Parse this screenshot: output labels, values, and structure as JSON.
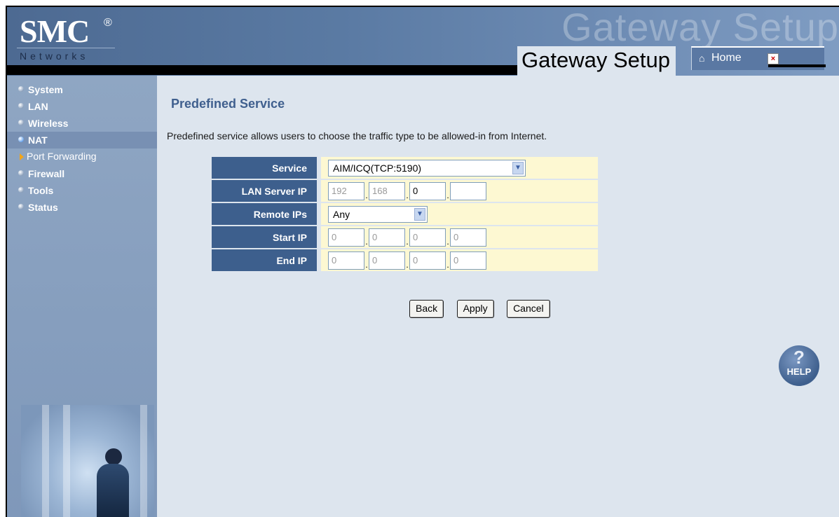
{
  "header": {
    "logo_text": "SMC",
    "logo_reg": "®",
    "logo_sub": "Networks",
    "watermark": "Gateway Setup",
    "title": "Gateway Setup",
    "home_label": "Home",
    "close_glyph": "×"
  },
  "sidebar": {
    "items": [
      {
        "label": "System"
      },
      {
        "label": "LAN"
      },
      {
        "label": "Wireless"
      },
      {
        "label": "NAT"
      },
      {
        "label": "Port Forwarding"
      },
      {
        "label": "Firewall"
      },
      {
        "label": "Tools"
      },
      {
        "label": "Status"
      }
    ]
  },
  "main": {
    "title": "Predefined Service",
    "description": "Predefined service allows users to choose the traffic type to be allowed-in from Internet.",
    "form": {
      "service_label": "Service",
      "service_value": "AIM/ICQ(TCP:5190)",
      "lan_ip_label": "LAN Server IP",
      "lan_ip": [
        "192",
        "168",
        "0",
        ""
      ],
      "remote_label": "Remote IPs",
      "remote_value": "Any",
      "start_label": "Start IP",
      "start_ip": [
        "0",
        "0",
        "0",
        "0"
      ],
      "end_label": "End IP",
      "end_ip": [
        "0",
        "0",
        "0",
        "0"
      ]
    },
    "buttons": {
      "back": "Back",
      "apply": "Apply",
      "cancel": "Cancel"
    },
    "help": {
      "q": "?",
      "text": "HELP"
    }
  },
  "colors": {
    "header_bg": "#5a7aa3",
    "label_bg": "#3d5f8d",
    "value_bg": "#fdf8d2",
    "page_bg": "#dde5ee",
    "title_color": "#3f5f8e"
  },
  "icons": {
    "home": "home-icon",
    "close": "close-icon",
    "dropdown": "chevron-down-icon",
    "bullet": "bullet-dot-icon",
    "arrow": "triangle-right-icon",
    "help": "help-icon"
  }
}
